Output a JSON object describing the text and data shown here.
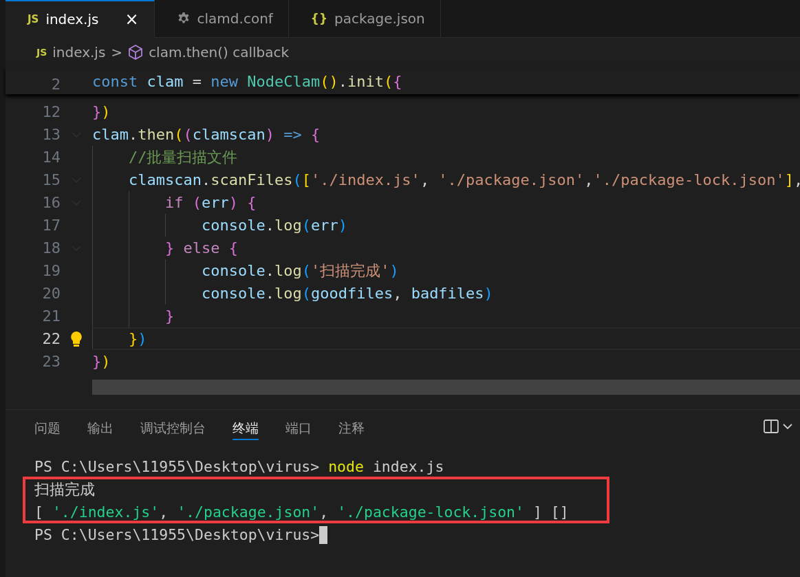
{
  "tabs": [
    {
      "icon": "JS",
      "kind": "js",
      "label": "index.js",
      "selected": true,
      "close": "×"
    },
    {
      "kind": "config",
      "label": "clamd.conf",
      "selected": false
    },
    {
      "icon": "{}",
      "kind": "json",
      "label": "package.json",
      "selected": false
    }
  ],
  "breadcrumb": {
    "file_icon": "JS",
    "file": "index.js",
    "separator": ">",
    "symbol": "clam.then() callback"
  },
  "editor": {
    "sticky_line": {
      "number": "2",
      "tokens": [
        {
          "text": "const",
          "kind": "keyword"
        },
        {
          "text": " clam",
          "kind": "variable"
        },
        {
          "text": " =",
          "kind": "plain"
        },
        {
          "text": " new",
          "kind": "keyword"
        },
        {
          "text": " NodeClam",
          "kind": "class"
        },
        {
          "text": "(",
          "kind": "bracket1"
        },
        {
          "text": ")",
          "kind": "bracket1"
        },
        {
          "text": ".",
          "kind": "plain"
        },
        {
          "text": "init",
          "kind": "function"
        },
        {
          "text": "(",
          "kind": "bracket1"
        },
        {
          "text": "{",
          "kind": "bracket2"
        }
      ]
    },
    "lines": [
      {
        "number": "12",
        "current": false,
        "fold": false,
        "tokens": [
          {
            "text": "}",
            "kind": "bracket2"
          },
          {
            "text": ")",
            "kind": "bracket1"
          }
        ]
      },
      {
        "number": "13",
        "current": false,
        "fold": true,
        "tokens": [
          {
            "text": "clam",
            "kind": "variable"
          },
          {
            "text": ".",
            "kind": "plain"
          },
          {
            "text": "then",
            "kind": "function"
          },
          {
            "text": "(",
            "kind": "bracket1"
          },
          {
            "text": "(",
            "kind": "bracket2"
          },
          {
            "text": "clamscan",
            "kind": "variable"
          },
          {
            "text": ")",
            "kind": "bracket2"
          },
          {
            "text": " =>",
            "kind": "keyword"
          },
          {
            "text": " {",
            "kind": "bracket2"
          }
        ]
      },
      {
        "number": "14",
        "current": false,
        "fold": false,
        "tokens": [
          {
            "text": "    //批量扫描文件",
            "kind": "comment"
          }
        ]
      },
      {
        "number": "15",
        "current": false,
        "fold": true,
        "tokens": [
          {
            "text": "    clamscan",
            "kind": "variable"
          },
          {
            "text": ".",
            "kind": "plain"
          },
          {
            "text": "scanFiles",
            "kind": "function"
          },
          {
            "text": "(",
            "kind": "bracket3"
          },
          {
            "text": "[",
            "kind": "bracket1"
          },
          {
            "text": "'./index.js'",
            "kind": "string"
          },
          {
            "text": ",",
            "kind": "plain"
          },
          {
            "text": " './package.json'",
            "kind": "string"
          },
          {
            "text": ",",
            "kind": "plain"
          },
          {
            "text": "'./package-lock.json'",
            "kind": "string"
          },
          {
            "text": "]",
            "kind": "bracket1"
          },
          {
            "text": ",",
            "kind": "plain"
          }
        ]
      },
      {
        "number": "16",
        "current": false,
        "fold": true,
        "tokens": [
          {
            "text": "        if",
            "kind": "control"
          },
          {
            "text": " (",
            "kind": "bracket2"
          },
          {
            "text": "err",
            "kind": "variable"
          },
          {
            "text": ")",
            "kind": "bracket2"
          },
          {
            "text": " {",
            "kind": "bracket2"
          }
        ]
      },
      {
        "number": "17",
        "current": false,
        "fold": false,
        "tokens": [
          {
            "text": "            console",
            "kind": "variable"
          },
          {
            "text": ".",
            "kind": "plain"
          },
          {
            "text": "log",
            "kind": "function"
          },
          {
            "text": "(",
            "kind": "bracket3"
          },
          {
            "text": "err",
            "kind": "variable"
          },
          {
            "text": ")",
            "kind": "bracket3"
          }
        ]
      },
      {
        "number": "18",
        "current": false,
        "fold": true,
        "tokens": [
          {
            "text": "        }",
            "kind": "bracket2"
          },
          {
            "text": " else",
            "kind": "control"
          },
          {
            "text": " {",
            "kind": "bracket2"
          }
        ]
      },
      {
        "number": "19",
        "current": false,
        "fold": false,
        "tokens": [
          {
            "text": "            console",
            "kind": "variable"
          },
          {
            "text": ".",
            "kind": "plain"
          },
          {
            "text": "log",
            "kind": "function"
          },
          {
            "text": "(",
            "kind": "bracket3"
          },
          {
            "text": "'扫描完成'",
            "kind": "string"
          },
          {
            "text": ")",
            "kind": "bracket3"
          }
        ]
      },
      {
        "number": "20",
        "current": false,
        "fold": false,
        "tokens": [
          {
            "text": "            console",
            "kind": "variable"
          },
          {
            "text": ".",
            "kind": "plain"
          },
          {
            "text": "log",
            "kind": "function"
          },
          {
            "text": "(",
            "kind": "bracket3"
          },
          {
            "text": "goodfiles",
            "kind": "variable"
          },
          {
            "text": ",",
            "kind": "plain"
          },
          {
            "text": " badfiles",
            "kind": "variable"
          },
          {
            "text": ")",
            "kind": "bracket3"
          }
        ]
      },
      {
        "number": "21",
        "current": false,
        "fold": false,
        "tokens": [
          {
            "text": "        }",
            "kind": "bracket2"
          }
        ]
      },
      {
        "number": "22",
        "current": true,
        "fold": false,
        "tokens": [
          {
            "text": "    }",
            "kind": "bracket1"
          },
          {
            "text": ")",
            "kind": "bracket3"
          }
        ]
      },
      {
        "number": "23",
        "current": false,
        "fold": false,
        "tokens": [
          {
            "text": "}",
            "kind": "bracket2"
          },
          {
            "text": ")",
            "kind": "bracket1"
          }
        ]
      }
    ]
  },
  "panel": {
    "tabs": [
      {
        "label": "问题",
        "selected": false
      },
      {
        "label": "输出",
        "selected": false
      },
      {
        "label": "调试控制台",
        "selected": false
      },
      {
        "label": "终端",
        "selected": true
      },
      {
        "label": "端口",
        "selected": false
      },
      {
        "label": "注释",
        "selected": false
      }
    ],
    "terminal": [
      {
        "cursor": false,
        "tokens": [
          {
            "text": "PS C:\\Users\\11955\\Desktop\\virus>",
            "kind": "plain"
          },
          {
            "text": " node",
            "kind": "command"
          },
          {
            "text": " index.js",
            "kind": "plain"
          }
        ]
      },
      {
        "cursor": false,
        "tokens": [
          {
            "text": "扫描完成",
            "kind": "plain"
          }
        ]
      },
      {
        "cursor": false,
        "tokens": [
          {
            "text": "[",
            "kind": "plain"
          },
          {
            "text": " './index.js'",
            "kind": "string"
          },
          {
            "text": ",",
            "kind": "plain"
          },
          {
            "text": " './package.json'",
            "kind": "string"
          },
          {
            "text": ",",
            "kind": "plain"
          },
          {
            "text": " './package-lock.json'",
            "kind": "string"
          },
          {
            "text": " ] []",
            "kind": "plain"
          }
        ]
      },
      {
        "cursor": true,
        "tokens": [
          {
            "text": "PS C:\\Users\\11955\\Desktop\\virus>",
            "kind": "plain"
          }
        ]
      }
    ]
  }
}
